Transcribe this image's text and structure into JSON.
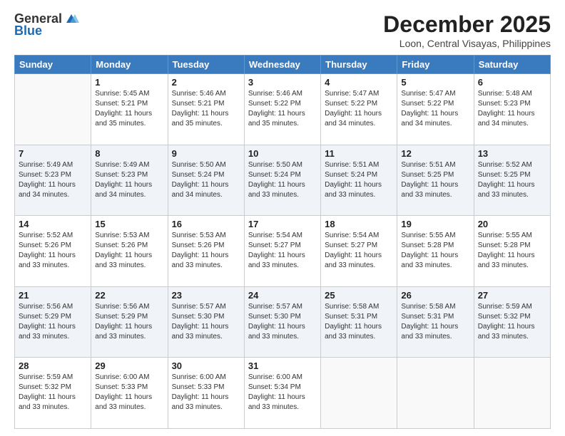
{
  "header": {
    "logo_general": "General",
    "logo_blue": "Blue",
    "title": "December 2025",
    "subtitle": "Loon, Central Visayas, Philippines"
  },
  "weekdays": [
    "Sunday",
    "Monday",
    "Tuesday",
    "Wednesday",
    "Thursday",
    "Friday",
    "Saturday"
  ],
  "weeks": [
    [
      {
        "day": "",
        "sunrise": "",
        "sunset": "",
        "daylight": ""
      },
      {
        "day": "1",
        "sunrise": "Sunrise: 5:45 AM",
        "sunset": "Sunset: 5:21 PM",
        "daylight": "Daylight: 11 hours and 35 minutes."
      },
      {
        "day": "2",
        "sunrise": "Sunrise: 5:46 AM",
        "sunset": "Sunset: 5:21 PM",
        "daylight": "Daylight: 11 hours and 35 minutes."
      },
      {
        "day": "3",
        "sunrise": "Sunrise: 5:46 AM",
        "sunset": "Sunset: 5:22 PM",
        "daylight": "Daylight: 11 hours and 35 minutes."
      },
      {
        "day": "4",
        "sunrise": "Sunrise: 5:47 AM",
        "sunset": "Sunset: 5:22 PM",
        "daylight": "Daylight: 11 hours and 34 minutes."
      },
      {
        "day": "5",
        "sunrise": "Sunrise: 5:47 AM",
        "sunset": "Sunset: 5:22 PM",
        "daylight": "Daylight: 11 hours and 34 minutes."
      },
      {
        "day": "6",
        "sunrise": "Sunrise: 5:48 AM",
        "sunset": "Sunset: 5:23 PM",
        "daylight": "Daylight: 11 hours and 34 minutes."
      }
    ],
    [
      {
        "day": "7",
        "sunrise": "Sunrise: 5:49 AM",
        "sunset": "Sunset: 5:23 PM",
        "daylight": "Daylight: 11 hours and 34 minutes."
      },
      {
        "day": "8",
        "sunrise": "Sunrise: 5:49 AM",
        "sunset": "Sunset: 5:23 PM",
        "daylight": "Daylight: 11 hours and 34 minutes."
      },
      {
        "day": "9",
        "sunrise": "Sunrise: 5:50 AM",
        "sunset": "Sunset: 5:24 PM",
        "daylight": "Daylight: 11 hours and 34 minutes."
      },
      {
        "day": "10",
        "sunrise": "Sunrise: 5:50 AM",
        "sunset": "Sunset: 5:24 PM",
        "daylight": "Daylight: 11 hours and 33 minutes."
      },
      {
        "day": "11",
        "sunrise": "Sunrise: 5:51 AM",
        "sunset": "Sunset: 5:24 PM",
        "daylight": "Daylight: 11 hours and 33 minutes."
      },
      {
        "day": "12",
        "sunrise": "Sunrise: 5:51 AM",
        "sunset": "Sunset: 5:25 PM",
        "daylight": "Daylight: 11 hours and 33 minutes."
      },
      {
        "day": "13",
        "sunrise": "Sunrise: 5:52 AM",
        "sunset": "Sunset: 5:25 PM",
        "daylight": "Daylight: 11 hours and 33 minutes."
      }
    ],
    [
      {
        "day": "14",
        "sunrise": "Sunrise: 5:52 AM",
        "sunset": "Sunset: 5:26 PM",
        "daylight": "Daylight: 11 hours and 33 minutes."
      },
      {
        "day": "15",
        "sunrise": "Sunrise: 5:53 AM",
        "sunset": "Sunset: 5:26 PM",
        "daylight": "Daylight: 11 hours and 33 minutes."
      },
      {
        "day": "16",
        "sunrise": "Sunrise: 5:53 AM",
        "sunset": "Sunset: 5:26 PM",
        "daylight": "Daylight: 11 hours and 33 minutes."
      },
      {
        "day": "17",
        "sunrise": "Sunrise: 5:54 AM",
        "sunset": "Sunset: 5:27 PM",
        "daylight": "Daylight: 11 hours and 33 minutes."
      },
      {
        "day": "18",
        "sunrise": "Sunrise: 5:54 AM",
        "sunset": "Sunset: 5:27 PM",
        "daylight": "Daylight: 11 hours and 33 minutes."
      },
      {
        "day": "19",
        "sunrise": "Sunrise: 5:55 AM",
        "sunset": "Sunset: 5:28 PM",
        "daylight": "Daylight: 11 hours and 33 minutes."
      },
      {
        "day": "20",
        "sunrise": "Sunrise: 5:55 AM",
        "sunset": "Sunset: 5:28 PM",
        "daylight": "Daylight: 11 hours and 33 minutes."
      }
    ],
    [
      {
        "day": "21",
        "sunrise": "Sunrise: 5:56 AM",
        "sunset": "Sunset: 5:29 PM",
        "daylight": "Daylight: 11 hours and 33 minutes."
      },
      {
        "day": "22",
        "sunrise": "Sunrise: 5:56 AM",
        "sunset": "Sunset: 5:29 PM",
        "daylight": "Daylight: 11 hours and 33 minutes."
      },
      {
        "day": "23",
        "sunrise": "Sunrise: 5:57 AM",
        "sunset": "Sunset: 5:30 PM",
        "daylight": "Daylight: 11 hours and 33 minutes."
      },
      {
        "day": "24",
        "sunrise": "Sunrise: 5:57 AM",
        "sunset": "Sunset: 5:30 PM",
        "daylight": "Daylight: 11 hours and 33 minutes."
      },
      {
        "day": "25",
        "sunrise": "Sunrise: 5:58 AM",
        "sunset": "Sunset: 5:31 PM",
        "daylight": "Daylight: 11 hours and 33 minutes."
      },
      {
        "day": "26",
        "sunrise": "Sunrise: 5:58 AM",
        "sunset": "Sunset: 5:31 PM",
        "daylight": "Daylight: 11 hours and 33 minutes."
      },
      {
        "day": "27",
        "sunrise": "Sunrise: 5:59 AM",
        "sunset": "Sunset: 5:32 PM",
        "daylight": "Daylight: 11 hours and 33 minutes."
      }
    ],
    [
      {
        "day": "28",
        "sunrise": "Sunrise: 5:59 AM",
        "sunset": "Sunset: 5:32 PM",
        "daylight": "Daylight: 11 hours and 33 minutes."
      },
      {
        "day": "29",
        "sunrise": "Sunrise: 6:00 AM",
        "sunset": "Sunset: 5:33 PM",
        "daylight": "Daylight: 11 hours and 33 minutes."
      },
      {
        "day": "30",
        "sunrise": "Sunrise: 6:00 AM",
        "sunset": "Sunset: 5:33 PM",
        "daylight": "Daylight: 11 hours and 33 minutes."
      },
      {
        "day": "31",
        "sunrise": "Sunrise: 6:00 AM",
        "sunset": "Sunset: 5:34 PM",
        "daylight": "Daylight: 11 hours and 33 minutes."
      },
      {
        "day": "",
        "sunrise": "",
        "sunset": "",
        "daylight": ""
      },
      {
        "day": "",
        "sunrise": "",
        "sunset": "",
        "daylight": ""
      },
      {
        "day": "",
        "sunrise": "",
        "sunset": "",
        "daylight": ""
      }
    ]
  ]
}
